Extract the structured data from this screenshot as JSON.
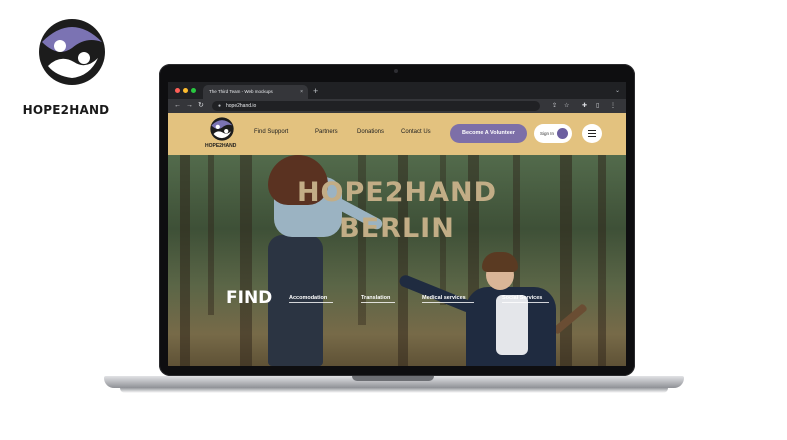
{
  "brand": {
    "name": "HOPE2HAND"
  },
  "browser": {
    "tab_title": "The Third Team - Web mockups",
    "tab_close": "×",
    "new_tab": "+",
    "tab_menu": "⌄",
    "url": "hope2hand.io",
    "nav_icons": {
      "back": "←",
      "forward": "→",
      "reload": "↻"
    },
    "toolbar_icons": [
      "share-icon",
      "star-icon",
      "extension-icon",
      "sidebar-icon",
      "more-icon"
    ]
  },
  "site": {
    "logo_text": "HOPE2HAND",
    "nav": [
      "Find Support",
      "Partners",
      "Donations",
      "Contact Us"
    ],
    "volunteer_button": "Become A Volunteer",
    "signin_label": "Sign In",
    "hero_title_line1": "HOPE2HAND",
    "hero_title_line2": "BERLIN",
    "find_label": "FIND",
    "services": [
      "Accomodation",
      "Translation",
      "Medical services",
      "Social Services"
    ]
  },
  "colors": {
    "header_bg": "#e3c27f",
    "accent_purple": "#7d6fa8",
    "logo_purple": "#7b73b3",
    "logo_dark": "#1c1c1c"
  }
}
